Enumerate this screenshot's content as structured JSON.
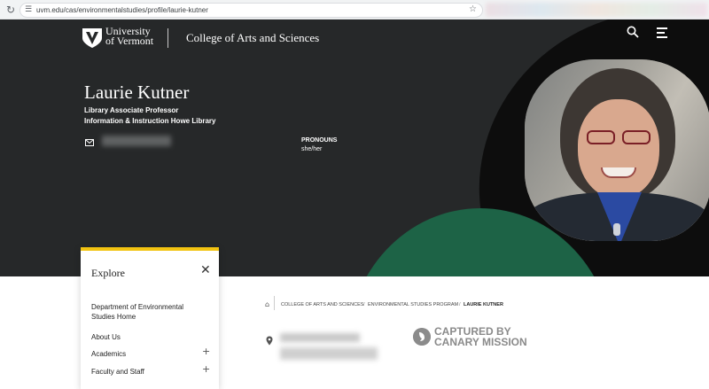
{
  "browser": {
    "url": "uvm.edu/cas/environmentalstudies/profile/laurie-kutner"
  },
  "header": {
    "logo_line1": "University",
    "logo_line2": "of Vermont",
    "college": "College of Arts and Sciences"
  },
  "profile": {
    "name": "Laurie Kutner",
    "title_line1": "Library Associate Professor",
    "title_line2": "Information & Instruction Howe Library",
    "pronouns_label": "PRONOUNS",
    "pronouns_value": "she/her"
  },
  "explore": {
    "title": "Explore",
    "items": [
      {
        "label_line1": "Department of Environmental",
        "label_line2": "Studies Home"
      },
      {
        "label": "About Us"
      },
      {
        "label": "Academics"
      },
      {
        "label": "Faculty and Staff"
      }
    ]
  },
  "breadcrumb": [
    "COLLEGE OF ARTS AND SCIENCES",
    "ENVIRONMENTAL STUDIES PROGRAM",
    "LAURIE KUTNER"
  ],
  "breadcrumb_separator": "/",
  "stamp": {
    "line1": "CAPTURED BY",
    "line2": "CANARY MISSION"
  },
  "colors": {
    "hero_bg": "#262829",
    "accent_green": "#1d6346",
    "accent_gold": "#f2c311"
  }
}
